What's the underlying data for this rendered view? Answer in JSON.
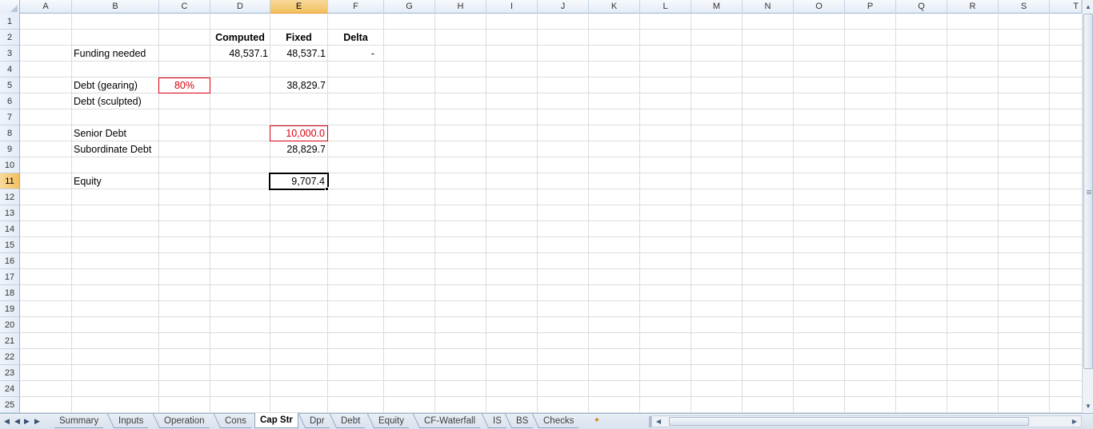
{
  "columns": [
    "A",
    "B",
    "C",
    "D",
    "E",
    "F",
    "G",
    "H",
    "I",
    "J",
    "K",
    "L",
    "M",
    "N",
    "O",
    "P",
    "Q",
    "R",
    "S",
    "T"
  ],
  "rows": [
    "1",
    "2",
    "3",
    "4",
    "5",
    "6",
    "7",
    "8",
    "9",
    "10",
    "11",
    "12",
    "13",
    "14",
    "15",
    "16",
    "17",
    "18",
    "19",
    "20",
    "21",
    "22",
    "23",
    "24",
    "25"
  ],
  "selected_column": "E",
  "selected_row": "11",
  "cells": {
    "d2": "Computed",
    "e2": "Fixed",
    "f2": "Delta",
    "b3": "Funding needed",
    "d3": "48,537.1",
    "e3": "48,537.1",
    "f3": "-",
    "b5": "Debt (gearing)",
    "c5": "80%",
    "e5": "38,829.7",
    "b6": "Debt (sculpted)",
    "b8": "Senior Debt",
    "e8": "10,000.0",
    "b9": "Subordinate Debt",
    "e9": "28,829.7",
    "b11": "Equity",
    "e11": "9,707.4"
  },
  "sheet_tabs": [
    "Summary",
    "Inputs",
    "Operation",
    "Cons",
    "Cap Str",
    "Dpr",
    "Debt",
    "Equity",
    "CF-Waterfall",
    "IS",
    "BS",
    "Checks"
  ],
  "active_tab": "Cap Str",
  "colors": {
    "input_red": "#d9000d",
    "header_selected": "#f1c15f"
  },
  "icons": {
    "first_sheet": "first-sheet-icon",
    "prev_sheet": "prev-sheet-icon",
    "next_sheet": "next-sheet-icon",
    "last_sheet": "last-sheet-icon",
    "insert_sheet": "insert-sheet-icon"
  }
}
